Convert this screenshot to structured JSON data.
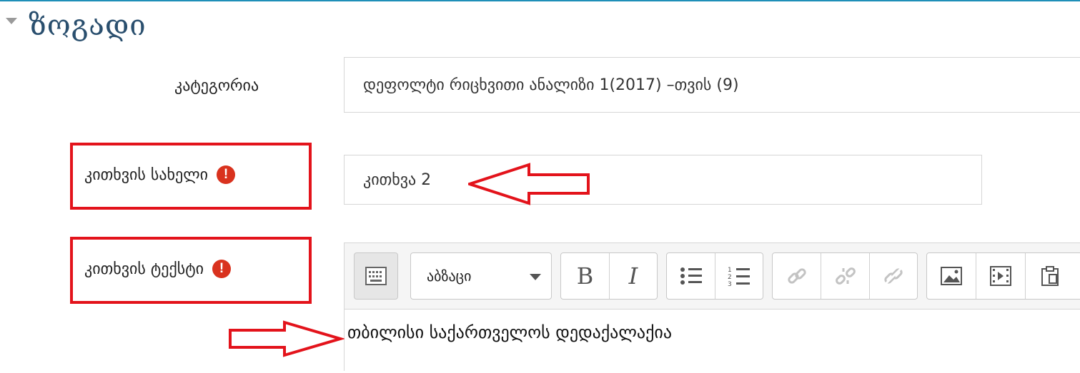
{
  "section": {
    "title": "ზოგადი"
  },
  "category": {
    "label": "კატეგორია",
    "value": "დეფოლტი რიცხვითი ანალიზი 1(2017) –თვის (9)"
  },
  "question_name": {
    "label": "კითხვის სახელი",
    "value": "კითხვა 2",
    "required_mark": "!"
  },
  "question_text": {
    "label": "კითხვის ტექსტი",
    "required_mark": "!",
    "content": "თბილისი საქართველოს დედაქალაქია"
  },
  "toolbar": {
    "paragraph_label": "აბზაცი",
    "bold_label": "B",
    "italic_label": "I"
  },
  "colors": {
    "accent": "#2a4f6e",
    "required": "#d9321e",
    "highlight_box": "#e3131b",
    "arrow": "#e3131b"
  }
}
